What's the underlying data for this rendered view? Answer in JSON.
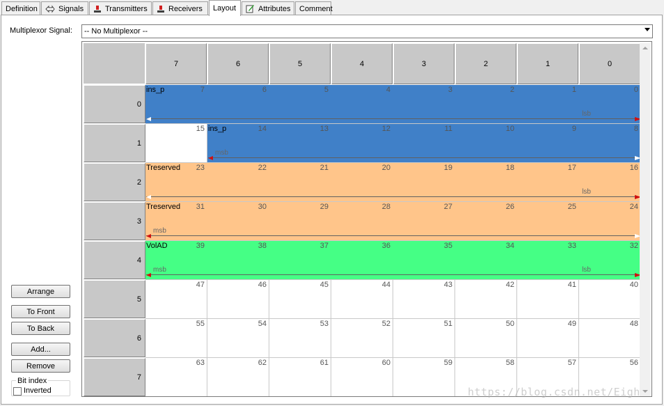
{
  "tabs": [
    {
      "label": "Definition",
      "icon": "none",
      "active": false
    },
    {
      "label": "Signals",
      "icon": "signals-icon",
      "active": false
    },
    {
      "label": "Transmitters",
      "icon": "node-icon",
      "active": false
    },
    {
      "label": "Receivers",
      "icon": "node-icon",
      "active": false
    },
    {
      "label": "Layout",
      "icon": "none",
      "active": true
    },
    {
      "label": "Attributes",
      "icon": "attributes-icon",
      "active": false
    },
    {
      "label": "Comment",
      "icon": "none",
      "active": false
    }
  ],
  "multiplexor": {
    "label": "Multiplexor Signal:",
    "value": "-- No Multiplexor --"
  },
  "grid": {
    "column_headers": [
      "7",
      "6",
      "5",
      "4",
      "3",
      "2",
      "1",
      "0"
    ],
    "row_headers": [
      "0",
      "1",
      "2",
      "3",
      "4",
      "5",
      "6",
      "7"
    ],
    "bit_numbers": [
      [
        "7",
        "6",
        "5",
        "4",
        "3",
        "2",
        "1",
        "0"
      ],
      [
        "15",
        "14",
        "13",
        "12",
        "11",
        "10",
        "9",
        "8"
      ],
      [
        "23",
        "22",
        "21",
        "20",
        "19",
        "18",
        "17",
        "16"
      ],
      [
        "31",
        "30",
        "29",
        "28",
        "27",
        "26",
        "25",
        "24"
      ],
      [
        "39",
        "38",
        "37",
        "36",
        "35",
        "34",
        "33",
        "32"
      ],
      [
        "47",
        "46",
        "45",
        "44",
        "43",
        "42",
        "41",
        "40"
      ],
      [
        "55",
        "54",
        "53",
        "52",
        "51",
        "50",
        "49",
        "48"
      ],
      [
        "63",
        "62",
        "61",
        "60",
        "59",
        "58",
        "57",
        "56"
      ]
    ],
    "signals": [
      {
        "row": 0,
        "from_col": 0,
        "to_col": 7,
        "name": "ins_p",
        "color": "#4080c8",
        "left_tag": "",
        "right_tag": "lsb",
        "arrow_left": "#ffffff",
        "arrow_right": "#d01010"
      },
      {
        "row": 1,
        "from_col": 1,
        "to_col": 7,
        "name": "ins_p",
        "color": "#4080c8",
        "left_tag": "msb",
        "right_tag": "",
        "arrow_left": "#d01010",
        "arrow_right": "#ffffff"
      },
      {
        "row": 2,
        "from_col": 0,
        "to_col": 7,
        "name": "Treserved",
        "color": "#ffc58a",
        "left_tag": "",
        "right_tag": "lsb",
        "arrow_left": "#ffffff",
        "arrow_right": "#d01010"
      },
      {
        "row": 3,
        "from_col": 0,
        "to_col": 7,
        "name": "Treserved",
        "color": "#ffc58a",
        "left_tag": "msb",
        "right_tag": "",
        "arrow_left": "#d01010",
        "arrow_right": "#ffffff"
      },
      {
        "row": 4,
        "from_col": 0,
        "to_col": 7,
        "name": "VolAD",
        "color": "#45ff85",
        "left_tag": "msb",
        "right_tag": "lsb",
        "arrow_left": "#d01010",
        "arrow_right": "#d01010"
      }
    ]
  },
  "buttons": {
    "arrange": "Arrange",
    "to_front": "To Front",
    "to_back": "To Back",
    "add": "Add...",
    "remove": "Remove"
  },
  "bit_index": {
    "title": "Bit index",
    "inverted_label": "Inverted",
    "inverted_checked": false
  },
  "watermark": "https://blog.csdn.net/Eigh"
}
